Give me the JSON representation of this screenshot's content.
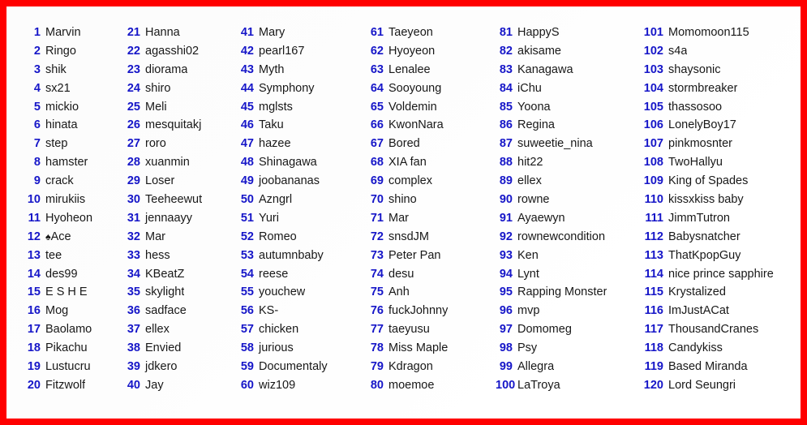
{
  "frame": {
    "border_color": "#ff0000",
    "background_color": "#ffffff",
    "rank_color": "#1616c8",
    "name_color": "#181818"
  },
  "list": {
    "total_entries": 120,
    "columns": [
      {
        "column_index": 1,
        "entries": [
          {
            "rank": "1",
            "name": "Marvin"
          },
          {
            "rank": "2",
            "name": "Ringo"
          },
          {
            "rank": "3",
            "name": "shik"
          },
          {
            "rank": "4",
            "name": "sx21"
          },
          {
            "rank": "5",
            "name": "mickio"
          },
          {
            "rank": "6",
            "name": "hinata"
          },
          {
            "rank": "7",
            "name": "step"
          },
          {
            "rank": "8",
            "name": "hamster"
          },
          {
            "rank": "9",
            "name": "crack"
          },
          {
            "rank": "10",
            "name": "mirukiis"
          },
          {
            "rank": "11",
            "name": "Hyoheon"
          },
          {
            "rank": "12",
            "name": "♠Ace"
          },
          {
            "rank": "13",
            "name": "tee"
          },
          {
            "rank": "14",
            "name": "des99"
          },
          {
            "rank": "15",
            "name": "E S H E"
          },
          {
            "rank": "16",
            "name": "Mog"
          },
          {
            "rank": "17",
            "name": "Baolamo"
          },
          {
            "rank": "18",
            "name": "Pikachu"
          },
          {
            "rank": "19",
            "name": "Lustucru"
          },
          {
            "rank": "20",
            "name": "Fitzwolf"
          }
        ]
      },
      {
        "column_index": 2,
        "entries": [
          {
            "rank": "21",
            "name": "Hanna"
          },
          {
            "rank": "22",
            "name": "agasshi02"
          },
          {
            "rank": "23",
            "name": "diorama"
          },
          {
            "rank": "24",
            "name": "shiro"
          },
          {
            "rank": "25",
            "name": "Meli"
          },
          {
            "rank": "26",
            "name": "mesquitakj"
          },
          {
            "rank": "27",
            "name": "roro"
          },
          {
            "rank": "28",
            "name": "xuanmin"
          },
          {
            "rank": "29",
            "name": "Loser"
          },
          {
            "rank": "30",
            "name": "Teeheewut"
          },
          {
            "rank": "31",
            "name": "jennaayy"
          },
          {
            "rank": "32",
            "name": "Mar"
          },
          {
            "rank": "33",
            "name": "hess"
          },
          {
            "rank": "34",
            "name": "KBeatZ"
          },
          {
            "rank": "35",
            "name": "skylight"
          },
          {
            "rank": "36",
            "name": "sadface"
          },
          {
            "rank": "37",
            "name": "ellex"
          },
          {
            "rank": "38",
            "name": "Envied"
          },
          {
            "rank": "39",
            "name": "jdkero"
          },
          {
            "rank": "40",
            "name": "Jay"
          }
        ]
      },
      {
        "column_index": 3,
        "entries": [
          {
            "rank": "41",
            "name": "Mary"
          },
          {
            "rank": "42",
            "name": "pearl167"
          },
          {
            "rank": "43",
            "name": "Myth"
          },
          {
            "rank": "44",
            "name": "Symphony"
          },
          {
            "rank": "45",
            "name": "mglsts"
          },
          {
            "rank": "46",
            "name": "Taku"
          },
          {
            "rank": "47",
            "name": "hazee"
          },
          {
            "rank": "48",
            "name": "Shinagawa"
          },
          {
            "rank": "49",
            "name": "joobananas"
          },
          {
            "rank": "50",
            "name": "Azngrl"
          },
          {
            "rank": "51",
            "name": "Yuri"
          },
          {
            "rank": "52",
            "name": "Romeo"
          },
          {
            "rank": "53",
            "name": "autumnbaby"
          },
          {
            "rank": "54",
            "name": "reese"
          },
          {
            "rank": "55",
            "name": "youchew"
          },
          {
            "rank": "56",
            "name": "KS-"
          },
          {
            "rank": "57",
            "name": "chicken"
          },
          {
            "rank": "58",
            "name": "jurious"
          },
          {
            "rank": "59",
            "name": "Documentaly"
          },
          {
            "rank": "60",
            "name": "wiz109"
          }
        ]
      },
      {
        "column_index": 4,
        "entries": [
          {
            "rank": "61",
            "name": "Taeyeon"
          },
          {
            "rank": "62",
            "name": "Hyoyeon"
          },
          {
            "rank": "63",
            "name": "Lenalee"
          },
          {
            "rank": "64",
            "name": "Sooyoung"
          },
          {
            "rank": "65",
            "name": "Voldemin"
          },
          {
            "rank": "66",
            "name": "KwonNara"
          },
          {
            "rank": "67",
            "name": "Bored"
          },
          {
            "rank": "68",
            "name": "XIA fan"
          },
          {
            "rank": "69",
            "name": "complex"
          },
          {
            "rank": "70",
            "name": "shino"
          },
          {
            "rank": "71",
            "name": "Mar"
          },
          {
            "rank": "72",
            "name": "snsdJM"
          },
          {
            "rank": "73",
            "name": "Peter Pan"
          },
          {
            "rank": "74",
            "name": "desu"
          },
          {
            "rank": "75",
            "name": "Anh"
          },
          {
            "rank": "76",
            "name": "fuckJohnny"
          },
          {
            "rank": "77",
            "name": "taeyusu"
          },
          {
            "rank": "78",
            "name": "Miss Maple"
          },
          {
            "rank": "79",
            "name": "Kdragon"
          },
          {
            "rank": "80",
            "name": "moemoe"
          }
        ]
      },
      {
        "column_index": 5,
        "entries": [
          {
            "rank": "81",
            "name": "HappyS"
          },
          {
            "rank": "82",
            "name": "akisame"
          },
          {
            "rank": "83",
            "name": "Kanagawa"
          },
          {
            "rank": "84",
            "name": "iChu"
          },
          {
            "rank": "85",
            "name": "Yoona"
          },
          {
            "rank": "86",
            "name": "Regina"
          },
          {
            "rank": "87",
            "name": "suweetie_nina"
          },
          {
            "rank": "88",
            "name": "hit22"
          },
          {
            "rank": "89",
            "name": "ellex"
          },
          {
            "rank": "90",
            "name": "rowne"
          },
          {
            "rank": "91",
            "name": "Ayaewyn"
          },
          {
            "rank": "92",
            "name": "rownewcondition"
          },
          {
            "rank": "93",
            "name": "Ken"
          },
          {
            "rank": "94",
            "name": "Lynt"
          },
          {
            "rank": "95",
            "name": "Rapping Monster"
          },
          {
            "rank": "96",
            "name": "mvp"
          },
          {
            "rank": "97",
            "name": "Domomeg"
          },
          {
            "rank": "98",
            "name": "Psy"
          },
          {
            "rank": "99",
            "name": "Allegra"
          },
          {
            "rank": "100",
            "name": "LaTroya"
          }
        ]
      },
      {
        "column_index": 6,
        "entries": [
          {
            "rank": "101",
            "name": "Momomoon115"
          },
          {
            "rank": "102",
            "name": "s4a"
          },
          {
            "rank": "103",
            "name": "shaysonic"
          },
          {
            "rank": "104",
            "name": "stormbreaker"
          },
          {
            "rank": "105",
            "name": "thassosoo"
          },
          {
            "rank": "106",
            "name": "LonelyBoy17"
          },
          {
            "rank": "107",
            "name": "pinkmosnter"
          },
          {
            "rank": "108",
            "name": "TwoHallyu"
          },
          {
            "rank": "109",
            "name": "King of Spades"
          },
          {
            "rank": "110",
            "name": "kissxkiss baby"
          },
          {
            "rank": "111",
            "name": "JimmTutron"
          },
          {
            "rank": "112",
            "name": "Babysnatcher"
          },
          {
            "rank": "113",
            "name": "ThatKpopGuy"
          },
          {
            "rank": "114",
            "name": "nice prince sapphire"
          },
          {
            "rank": "115",
            "name": "Krystalized"
          },
          {
            "rank": "116",
            "name": "ImJustACat"
          },
          {
            "rank": "117",
            "name": "ThousandCranes"
          },
          {
            "rank": "118",
            "name": "Candykiss"
          },
          {
            "rank": "119",
            "name": "Based Miranda"
          },
          {
            "rank": "120",
            "name": "Lord Seungri"
          }
        ]
      }
    ]
  }
}
